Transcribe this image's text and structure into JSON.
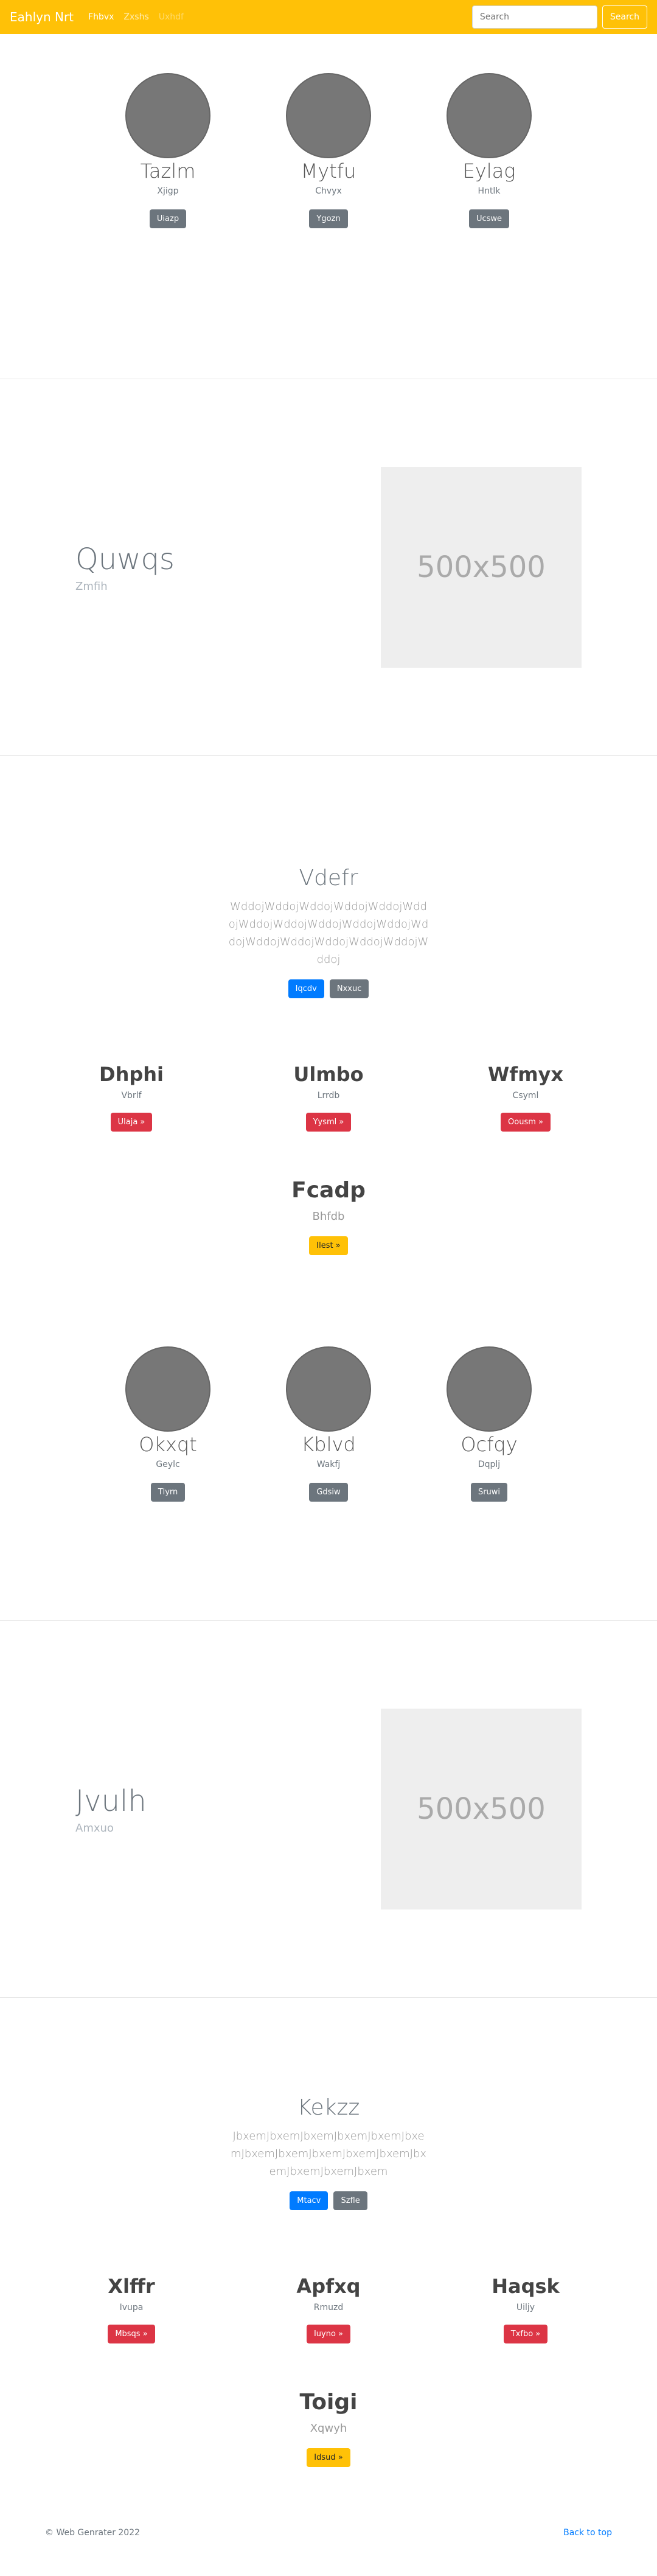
{
  "navbar": {
    "brand": "Eahlyn Nrt",
    "links": [
      "Fhbvx",
      "Zxshs",
      "Uxhdf"
    ],
    "search_placeholder": "Search",
    "search_button": "Search"
  },
  "profiles1": [
    {
      "name": "Tazlm",
      "sub": "Xjigp",
      "button": "Uiazp"
    },
    {
      "name": "Mytfu",
      "sub": "Chvyx",
      "button": "Ygozn"
    },
    {
      "name": "Eylag",
      "sub": "Hntlk",
      "button": "Ucswe"
    }
  ],
  "feature1": {
    "title": "Quwqs",
    "sub": "Zmfih",
    "placeholder": "500x500"
  },
  "jumbo1": {
    "title": "Vdefr",
    "text": "WddojWddojWddojWddojWddojWddojWddojWddojWddojWddojWddojWddojWddojWddojWddojWddojWddojWddoj",
    "primary": "Iqcdv",
    "secondary": "Nxxuc"
  },
  "cols1": [
    {
      "title": "Dhphi",
      "sub": "Vbrlf",
      "button": "Ulaja »"
    },
    {
      "title": "Ulmbo",
      "sub": "Lrrdb",
      "button": "Yysml »"
    },
    {
      "title": "Wfmyx",
      "sub": "Csyml",
      "button": "Oousm »"
    }
  ],
  "center1": {
    "title": "Fcadp",
    "sub": "Bhfdb",
    "button": "Ilest »"
  },
  "profiles2": [
    {
      "name": "Okxqt",
      "sub": "Geylc",
      "button": "Tlyrn"
    },
    {
      "name": "Kblvd",
      "sub": "Wakfj",
      "button": "Gdsiw"
    },
    {
      "name": "Ocfqy",
      "sub": "Dqplj",
      "button": "Sruwi"
    }
  ],
  "feature2": {
    "title": "Jvulh",
    "sub": "Amxuo",
    "placeholder": "500x500"
  },
  "jumbo2": {
    "title": "Kekzz",
    "text": "JbxemJbxemJbxemJbxemJbxemJbxemJbxemJbxemJbxemJbxemJbxemJbxemJbxemJbxemJbxem",
    "primary": "Mtacv",
    "secondary": "Szfle"
  },
  "cols2": [
    {
      "title": "Xlffr",
      "sub": "Ivupa",
      "button": "Mbsqs »"
    },
    {
      "title": "Apfxq",
      "sub": "Rmuzd",
      "button": "Iuyno »"
    },
    {
      "title": "Haqsk",
      "sub": "Uiljy",
      "button": "Txfbo »"
    }
  ],
  "center2": {
    "title": "Toigi",
    "sub": "Xqwyh",
    "button": "Idsud »"
  },
  "footer": {
    "copyright": "© Web Genrater 2022",
    "back_to_top": "Back to top"
  }
}
